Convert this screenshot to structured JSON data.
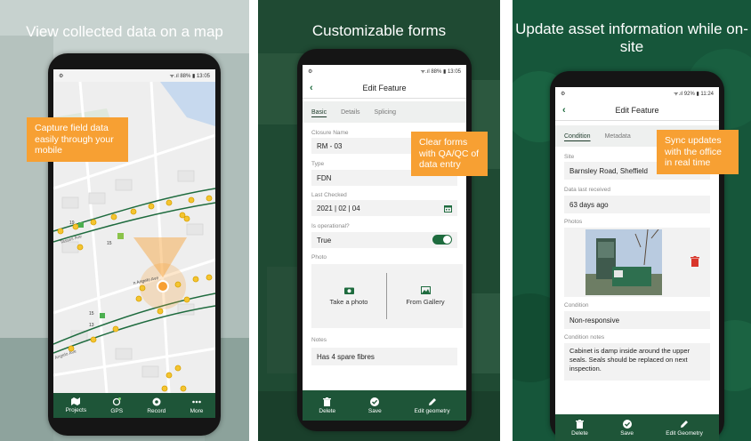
{
  "panel1": {
    "headline": "View collected data on a map",
    "status_left": "⚙",
    "status_right": "ᯤ.ıl 88% ▮ 13:05",
    "callout": "Capture field data easily through your mobile",
    "streets": {
      "s1": "Tasses Ave",
      "s2": "Angelo Ave",
      "s3": "n Angelo Ave"
    },
    "house_numbers": [
      "19",
      "15",
      "15",
      "13"
    ],
    "nav": [
      {
        "label": "Projects",
        "icon": "projects-icon"
      },
      {
        "label": "GPS",
        "icon": "gps-icon"
      },
      {
        "label": "Record",
        "icon": "record-icon"
      },
      {
        "label": "More",
        "icon": "more-icon"
      }
    ]
  },
  "panel2": {
    "headline": "Customizable forms",
    "status_left": "⚙",
    "status_right": "ᯤ.ıl 88% ▮ 13:05",
    "title": "Edit Feature",
    "tabs": [
      "Basic",
      "Details",
      "Splicing"
    ],
    "fields": {
      "closure_label": "Closure Name",
      "closure_value": "RM - 03",
      "type_label": "Type",
      "type_value": "FDN",
      "checked_label": "Last Checked",
      "checked_value": "2021 | 02 | 04",
      "operational_label": "Is operational?",
      "operational_value": "True",
      "photo_label": "Photo",
      "take_photo": "Take a photo",
      "from_gallery": "From Gallery",
      "notes_label": "Notes",
      "notes_value": "Has 4 spare fibres"
    },
    "callout": "Clear forms with QA/QC of data entry",
    "actions": [
      {
        "label": "Delete",
        "icon": "trash-icon"
      },
      {
        "label": "Save",
        "icon": "check-icon"
      },
      {
        "label": "Edit geometry",
        "icon": "pencil-icon"
      }
    ]
  },
  "panel3": {
    "headline": "Update asset information while on-site",
    "status_left": "⚙",
    "status_right": "ᯤ.ıl 92% ▮ 11:24",
    "title": "Edit Feature",
    "tabs": [
      "Condition",
      "Metadata"
    ],
    "fields": {
      "site_label": "Site",
      "site_value": "Barnsley Road, Sheffield",
      "received_label": "Data last received",
      "received_value": "63 days ago",
      "photos_label": "Photos",
      "condition_label": "Condition",
      "condition_value": "Non-responsive",
      "notes_label": "Condition notes",
      "notes_value": "Cabinet is damp inside around the upper seals. Seals should be replaced on next inspection."
    },
    "callout": "Sync updates with the office in real time",
    "actions": [
      {
        "label": "Delete",
        "icon": "trash-icon"
      },
      {
        "label": "Save",
        "icon": "check-icon"
      },
      {
        "label": "Edit Geometry",
        "icon": "pencil-icon"
      }
    ]
  },
  "colors": {
    "accent": "#1e6b3e",
    "bar": "#1e5538",
    "callout": "#f7a033",
    "point": "#f4c430"
  }
}
